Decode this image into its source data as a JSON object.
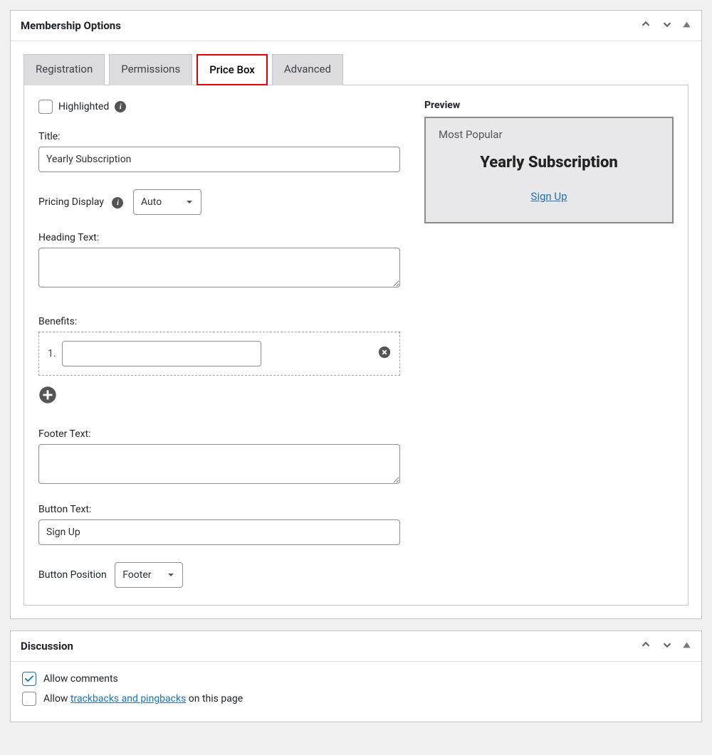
{
  "membership": {
    "panelTitle": "Membership Options",
    "tabs": {
      "registration": "Registration",
      "permissions": "Permissions",
      "priceBox": "Price Box",
      "advanced": "Advanced"
    },
    "highlighted": {
      "checked": false,
      "label": "Highlighted"
    },
    "title": {
      "label": "Title:",
      "value": "Yearly Subscription"
    },
    "pricingDisplay": {
      "label": "Pricing Display",
      "value": "Auto"
    },
    "headingText": {
      "label": "Heading Text:",
      "value": ""
    },
    "benefits": {
      "label": "Benefits:",
      "items": [
        {
          "number": "1.",
          "value": ""
        }
      ]
    },
    "footerText": {
      "label": "Footer Text:",
      "value": ""
    },
    "buttonText": {
      "label": "Button Text:",
      "value": "Sign Up"
    },
    "buttonPosition": {
      "label": "Button Position",
      "value": "Footer"
    },
    "preview": {
      "label": "Preview",
      "tag": "Most Popular",
      "title": "Yearly Subscription",
      "link": "Sign Up"
    }
  },
  "discussion": {
    "panelTitle": "Discussion",
    "allowCommentsChecked": true,
    "allowCommentsLabel": "Allow comments",
    "allowTrackbacksChecked": false,
    "allowTrackbacksPrefix": "Allow ",
    "allowTrackbacksLink": "trackbacks and pingbacks",
    "allowTrackbacksSuffix": " on this page"
  }
}
